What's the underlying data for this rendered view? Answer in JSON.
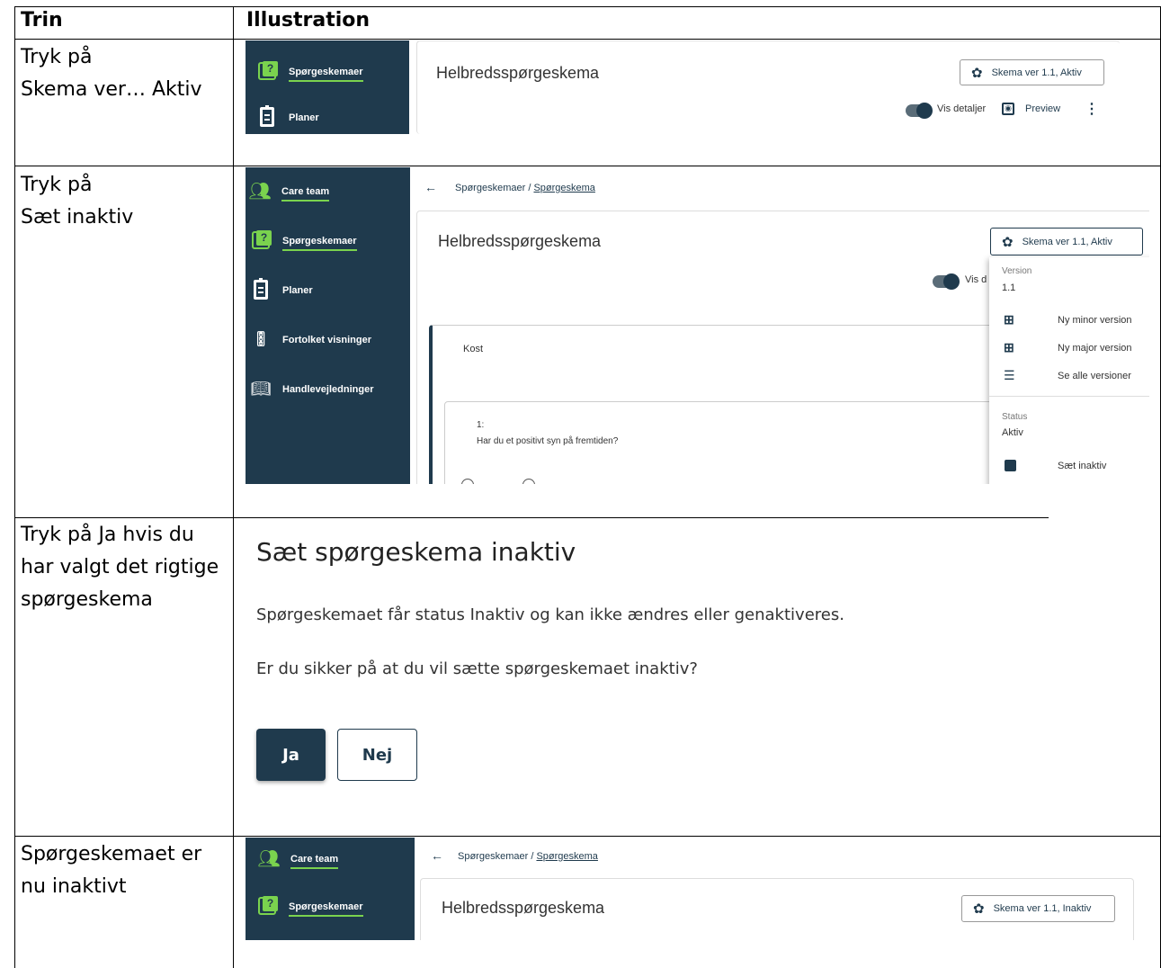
{
  "table": {
    "headers": [
      "Trin",
      "Illustration"
    ],
    "steps": [
      "Tryk på\nSkema ver… Aktiv",
      "Tryk på\nSæt inaktiv",
      "Tryk på\nJa hvis du har valgt det rigtige spørgeskema",
      "Spørgeskemaet er nu inaktivt"
    ]
  },
  "app": {
    "colors": {
      "sidebar": "#1f3a4d",
      "accent": "#7ad34e",
      "primary": "#1f3a4d"
    },
    "nav": {
      "care_team": "Care team",
      "questionnaires": "Spørgeskemaer",
      "plans": "Planer",
      "interpreted": "Fortolket visninger",
      "guides": "Handlevejledninger"
    },
    "page_title": "Helbredsspørgeskema",
    "breadcrumb": {
      "root": "Spørgeskemaer",
      "separator": "/",
      "current": "Spørgeskema"
    },
    "version_chip_active": "Skema ver 1.1, Aktiv",
    "version_chip_inactive": "Skema ver 1.1, Inaktiv",
    "show_details": "Vis detaljer",
    "show_details_cut": "Vis d",
    "preview": "Preview",
    "section": "Kost",
    "question": {
      "number": "1:",
      "text": "Har du et positivt syn på fremtiden?"
    },
    "menu": {
      "version_label": "Version",
      "version_value": "1.1",
      "new_minor": "Ny minor version",
      "new_major": "Ny major version",
      "see_all": "Se alle versioner",
      "status_label": "Status",
      "status_value": "Aktiv",
      "set_inactive": "Sæt inaktiv"
    }
  },
  "dialog": {
    "title": "Sæt spørgeskema inaktiv",
    "body1": "Spørgeskemaet får status Inaktiv og kan ikke ændres eller genaktiveres.",
    "body2": "Er du sikker på at du vil sætte spørgeskemaet inaktiv?",
    "yes": "Ja",
    "no": "Nej"
  }
}
